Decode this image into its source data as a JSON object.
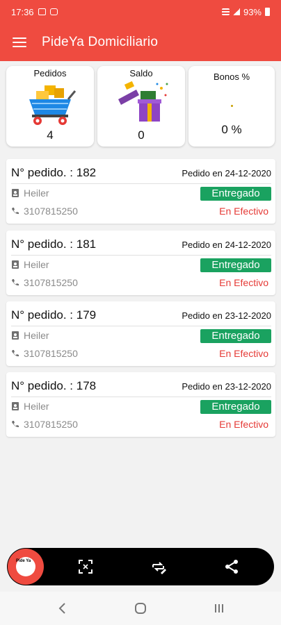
{
  "status_bar": {
    "time": "17:36",
    "battery": "93%"
  },
  "app_bar": {
    "title": "PideYa Domiciliario"
  },
  "stats": [
    {
      "label": "Pedidos",
      "value": "4",
      "icon": "shopping-cart-icon"
    },
    {
      "label": "Saldo",
      "value": "0",
      "icon": "gift-box-icon"
    },
    {
      "label": "Bonos %",
      "value": "0 %",
      "icon": "dot-icon"
    }
  ],
  "orders": [
    {
      "number": "N° pedido. : 182",
      "date": "Pedido en 24-12-2020",
      "customer": "Heiler",
      "phone": "3107815250",
      "status": "Entregado",
      "payment": "En Efectivo"
    },
    {
      "number": "N° pedido. : 181",
      "date": "Pedido en 24-12-2020",
      "customer": "Heiler",
      "phone": "3107815250",
      "status": "Entregado",
      "payment": "En Efectivo"
    },
    {
      "number": "N° pedido. : 179",
      "date": "Pedido en 23-12-2020",
      "customer": "Heiler",
      "phone": "3107815250",
      "status": "Entregado",
      "payment": "En Efectivo"
    },
    {
      "number": "N° pedido. : 178",
      "date": "Pedido en 23-12-2020",
      "customer": "Heiler",
      "phone": "3107815250",
      "status": "Entregado",
      "payment": "En Efectivo"
    }
  ],
  "bottom_nav": {
    "logo_text": "Pide Ya",
    "items": [
      "scan-icon",
      "edit-repeat-icon",
      "share-icon"
    ]
  },
  "colors": {
    "primary": "#ef4b40",
    "success": "#1aa260",
    "danger": "#e53935"
  }
}
